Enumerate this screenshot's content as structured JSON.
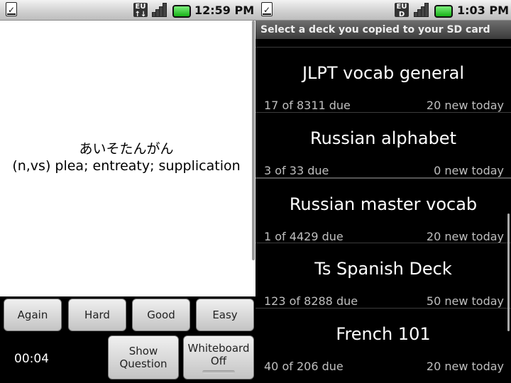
{
  "left": {
    "status": {
      "time": "12:59 PM",
      "eu": [
        "EU",
        "↑↓"
      ]
    },
    "card": {
      "question": "あいそたんがん",
      "answer": "(n,vs) plea; entreaty; supplication"
    },
    "buttons": {
      "again": "Again",
      "hard": "Hard",
      "good": "Good",
      "easy": "Easy"
    },
    "timer": "00:04",
    "show_question": [
      "Show",
      "Question"
    ],
    "whiteboard": [
      "Whiteboard",
      "Off"
    ]
  },
  "right": {
    "status": {
      "time": "1:03 PM",
      "eu": [
        "EU",
        "D"
      ]
    },
    "title": "Select a deck you copied to your SD card",
    "decks": [
      {
        "name": "JLPT vocab general",
        "due": "17 of 8311 due",
        "new": "20 new today"
      },
      {
        "name": "Russian alphabet",
        "due": "3 of 33 due",
        "new": "0 new today"
      },
      {
        "name": "Russian master vocab",
        "due": "1 of 4429 due",
        "new": "20 new today"
      },
      {
        "name": "Ts Spanish Deck",
        "due": "123 of 8288 due",
        "new": "50 new today"
      },
      {
        "name": "French 101",
        "due": "40 of 206 due",
        "new": "20 new today"
      }
    ]
  },
  "colors": {
    "battery": "#2ecc2e",
    "background": "#000000",
    "card": "#ffffff"
  },
  "icons": [
    "notification-download-icon",
    "eu-network-icon",
    "signal-icon",
    "battery-icon"
  ]
}
